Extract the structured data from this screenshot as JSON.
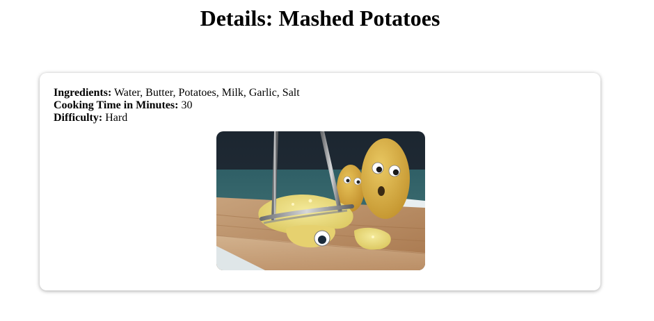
{
  "page": {
    "title": "Details: Mashed Potatoes"
  },
  "recipe": {
    "ingredients_label": "Ingredients:",
    "ingredients_value": "Water, Butter, Potatoes, Milk, Garlic, Salt",
    "cooking_time_label": "Cooking Time in Minutes:",
    "cooking_time_value": "30",
    "difficulty_label": "Difficulty:",
    "difficulty_value": "Hard"
  },
  "image": {
    "subject": "potato-masher-with-googly-eyed-potatoes-photo"
  }
}
